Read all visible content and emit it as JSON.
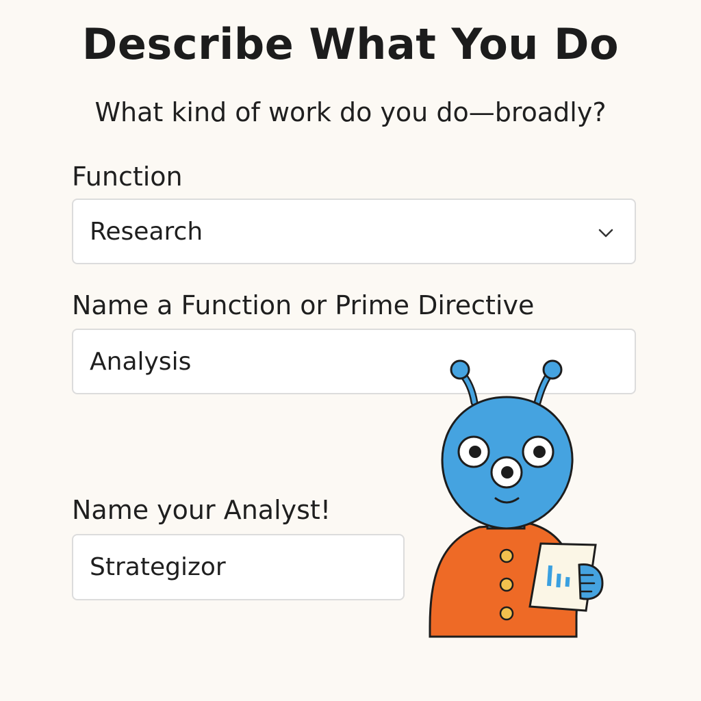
{
  "page": {
    "title": "Describe What You Do",
    "subtitle": "What kind of work do you do—broadly?"
  },
  "form": {
    "function": {
      "label": "Function",
      "selected": "Research",
      "icon": "chevron-down-icon"
    },
    "directive": {
      "label": "Name a Function or Prime Directive",
      "value": "Analysis"
    },
    "analyst": {
      "label": "Name your Analyst!",
      "value": "Strategizor"
    }
  },
  "mascot": {
    "description_icon": "alien-analyst-mascot",
    "colors": {
      "skin": "#45a3e0",
      "shirt": "#ee6a26",
      "buttons": "#f2c14e",
      "paper": "#fbf6e6"
    }
  }
}
